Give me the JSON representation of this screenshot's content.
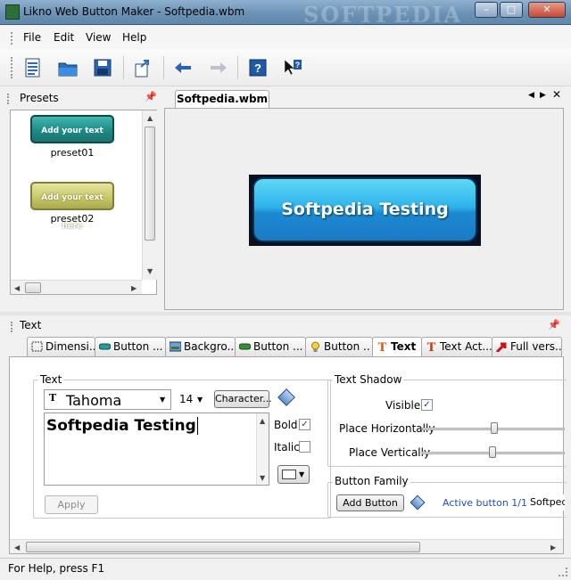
{
  "window": {
    "title": "Likno Web Button Maker - Softpedia.wbm",
    "watermark": "SOFTPEDIA"
  },
  "menu": [
    "File",
    "Edit",
    "View",
    "Help"
  ],
  "toolbar": {
    "icons": [
      "new-document-icon",
      "open-folder-icon",
      "save-icon",
      "export-icon",
      "undo-icon",
      "redo-icon",
      "help-icon",
      "context-help-icon"
    ]
  },
  "presets": {
    "header": "Presets",
    "items": [
      {
        "label": "preset01",
        "button_text": "Add your text here",
        "color": "#2a9a95"
      },
      {
        "label": "preset02",
        "button_text": "Add your text here",
        "color": "#c8c86a"
      }
    ]
  },
  "document": {
    "tab": "Softpedia.wbm",
    "preview_text": "Softpedia Testing"
  },
  "text_panel": {
    "header": "Text",
    "tabs": [
      "Dimensi...",
      "Button ...",
      "Backgro...",
      "Button ...",
      "Button ..",
      "Text",
      "Text Act...",
      "Full vers..."
    ],
    "active_tab": "Text",
    "text_group": {
      "label": "Text",
      "font": "Tahoma",
      "size": "14",
      "character_button": "Character...",
      "value": "Softpedia Testing",
      "bold_label": "Bold",
      "bold": true,
      "italic_label": "Italic",
      "italic": false,
      "apply_button": "Apply"
    },
    "shadow_group": {
      "label": "Text Shadow",
      "visible_label": "Visible",
      "visible": true,
      "horiz_label": "Place Horizontally",
      "horiz_value": 0.34,
      "vert_label": "Place Vertically",
      "vert_value": 0.33
    },
    "family_group": {
      "label": "Button Family",
      "add_button": "Add Button",
      "active_label": "Active button 1/1 :",
      "active_value": "Softped"
    }
  },
  "status": {
    "text": "For Help, press F1"
  },
  "colors": {
    "accent": "#1c79c4",
    "link": "#1f4fbf"
  }
}
